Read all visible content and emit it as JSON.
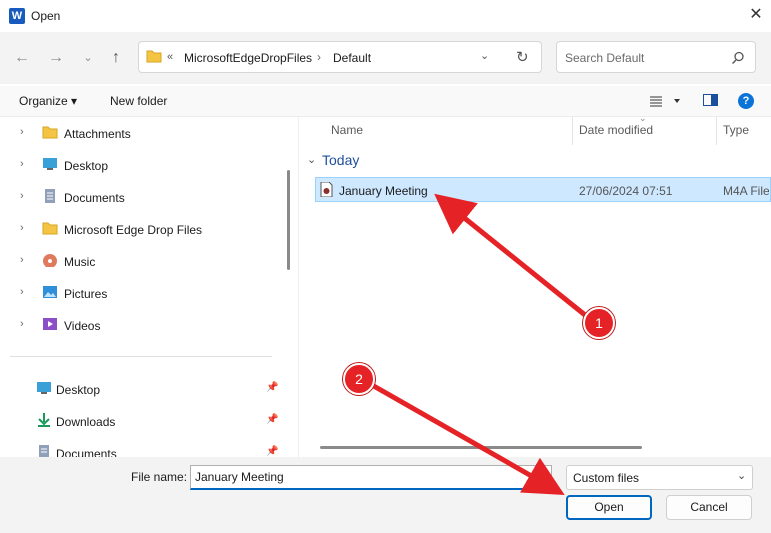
{
  "window": {
    "title": "Open",
    "app_icon_letter": "W"
  },
  "nav": {
    "path_overflow": "«",
    "path": [
      "MicrosoftEdgeDropFiles",
      "Default"
    ],
    "search_placeholder": "Search Default"
  },
  "toolbar": {
    "organize_label": "Organize ▾",
    "new_folder_label": "New folder",
    "help_glyph": "?"
  },
  "tree": {
    "items": [
      {
        "label": "Attachments",
        "icon": "folder-icon"
      },
      {
        "label": "Desktop",
        "icon": "desktop-icon"
      },
      {
        "label": "Documents",
        "icon": "documents-icon"
      },
      {
        "label": "Microsoft Edge Drop Files",
        "icon": "folder-icon"
      },
      {
        "label": "Music",
        "icon": "music-icon"
      },
      {
        "label": "Pictures",
        "icon": "pictures-icon"
      },
      {
        "label": "Videos",
        "icon": "videos-icon"
      }
    ],
    "quick_access": [
      {
        "label": "Desktop",
        "icon": "desktop-icon"
      },
      {
        "label": "Downloads",
        "icon": "downloads-icon"
      },
      {
        "label": "Documents",
        "icon": "documents-icon"
      }
    ]
  },
  "list": {
    "columns": [
      "Name",
      "Date modified",
      "Type"
    ],
    "group": "Today",
    "rows": [
      {
        "name": "January Meeting",
        "date": "27/06/2024 07:51",
        "type": "M4A File"
      }
    ]
  },
  "footer": {
    "file_name_label": "File name:",
    "file_name_value": "January Meeting",
    "file_type": "Custom files",
    "open_label": "Open",
    "cancel_label": "Cancel"
  },
  "annotations": {
    "callout_1": "1",
    "callout_2": "2",
    "arrow_color": "#e52226"
  }
}
